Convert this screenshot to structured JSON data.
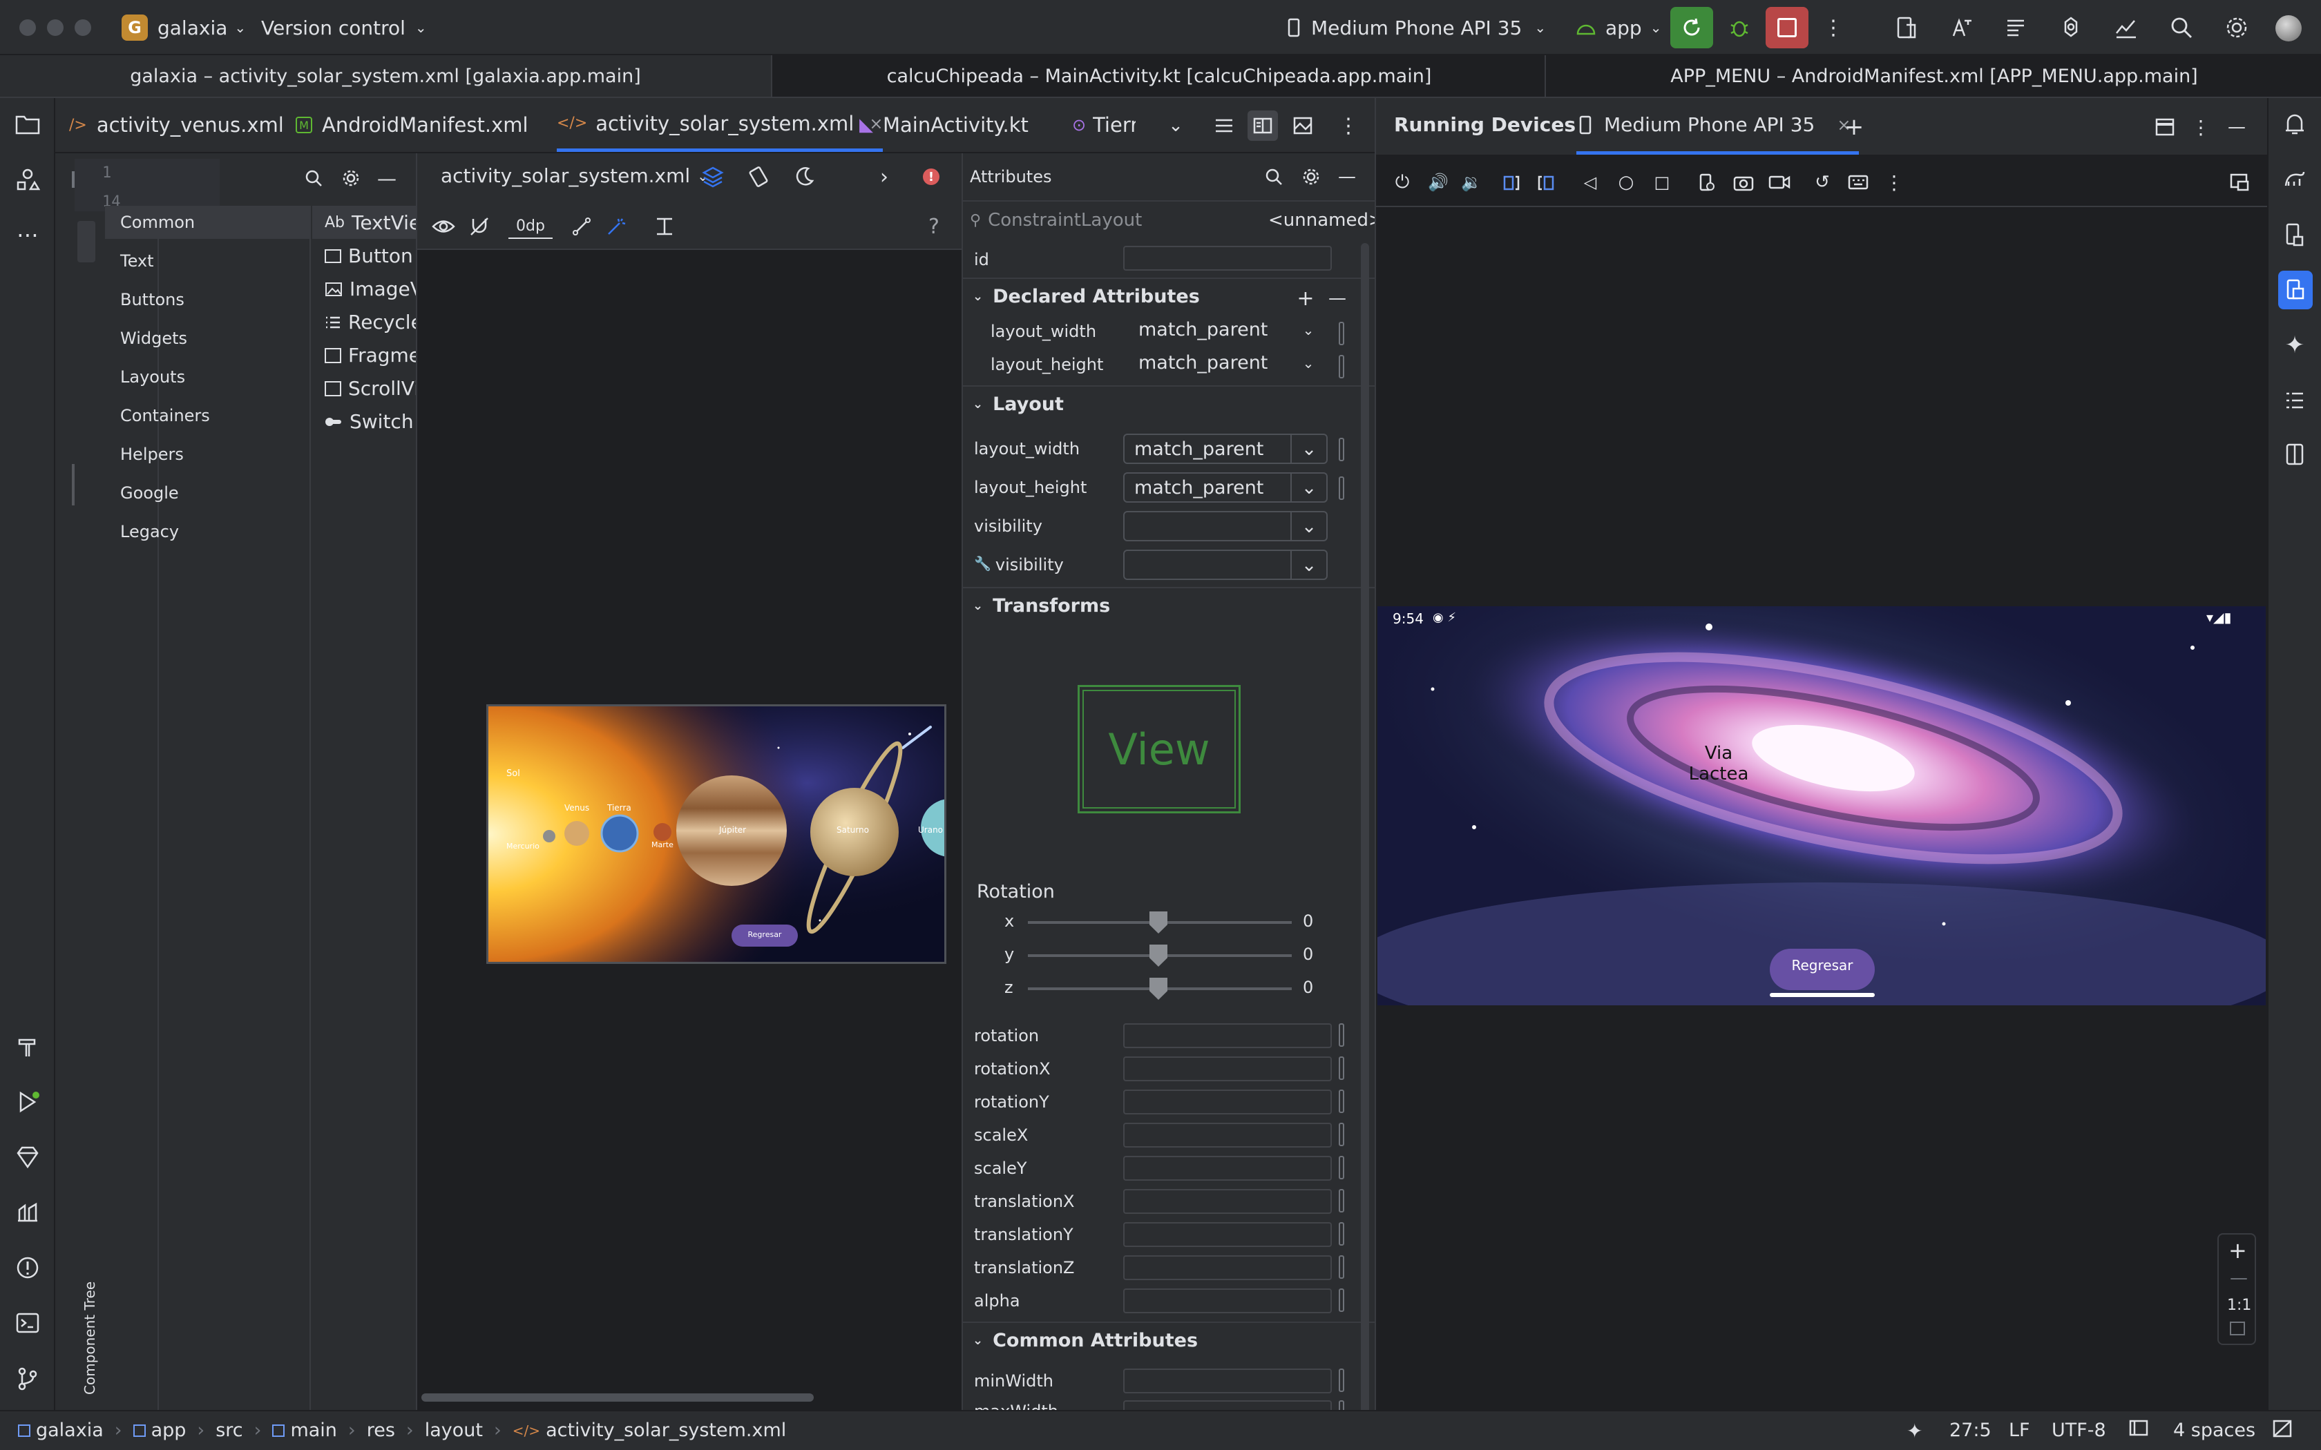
{
  "titlebar": {
    "project_initial": "G",
    "project": "galaxia",
    "vcs": "Version control",
    "device": "Medium Phone API 35",
    "run_config": "app"
  },
  "window_tabs": [
    "galaxia – activity_solar_system.xml [galaxia.app.main]",
    "calcuChipeada – MainActivity.kt [calcuChipeada.app.main]",
    "APP_MENU – AndroidManifest.xml [APP_MENU.app.main]"
  ],
  "editor_tabs": [
    {
      "label": "activity_venus.xml",
      "icon": "xml-file-icon"
    },
    {
      "label": "AndroidManifest.xml",
      "icon": "manifest-file-icon"
    },
    {
      "label": "activity_solar_system.xml",
      "icon": "xml-file-icon",
      "active": true
    },
    {
      "label": "MainActivity.kt",
      "icon": "kotlin-file-icon"
    },
    {
      "label": "Tierra",
      "icon": "layout-file-icon"
    }
  ],
  "gutter": {
    "line1": "1",
    "line2": "14"
  },
  "palette": {
    "categories": [
      "Common",
      "Text",
      "Buttons",
      "Widgets",
      "Layouts",
      "Containers",
      "Helpers",
      "Google",
      "Legacy"
    ],
    "selected_category": "Common",
    "widgets": [
      "TextView",
      "Button",
      "ImageVi...",
      "Recycler...",
      "Fragmen...",
      "ScrollView",
      "Switch"
    ],
    "textview_glyph": "Ab",
    "component_tree": "Component Tree"
  },
  "design": {
    "file": "activity_solar_system.xml",
    "margin": "0dp",
    "help": "?",
    "preview": {
      "labels": {
        "sol": "Sol",
        "mercurio": "Mercurio",
        "venus": "Venus",
        "tierra": "Tierra",
        "marte": "Marte",
        "jupiter": "Júpiter",
        "saturno": "Saturno",
        "urano": "Urano"
      },
      "button": "Regresar"
    }
  },
  "attributes": {
    "title": "Attributes",
    "component": "ConstraintLayout",
    "component_name": "<unnamed>",
    "id_label": "id",
    "declared": {
      "title": "Declared Attributes",
      "rows": [
        {
          "name": "layout_width",
          "value": "match_parent"
        },
        {
          "name": "layout_height",
          "value": "match_parent"
        }
      ]
    },
    "layout": {
      "title": "Layout",
      "rows": [
        {
          "name": "layout_width",
          "value": "match_parent"
        },
        {
          "name": "layout_height",
          "value": "match_parent"
        },
        {
          "name": "visibility",
          "value": ""
        },
        {
          "name": "visibility",
          "value": ""
        }
      ]
    },
    "transforms": {
      "title": "Transforms",
      "view_preview": "View",
      "rotation_label": "Rotation",
      "axes": [
        {
          "name": "x",
          "value": "0"
        },
        {
          "name": "y",
          "value": "0"
        },
        {
          "name": "z",
          "value": "0"
        }
      ],
      "fields": [
        "rotation",
        "rotationX",
        "rotationY",
        "scaleX",
        "scaleY",
        "translationX",
        "translationY",
        "translationZ",
        "alpha"
      ]
    },
    "common": {
      "title": "Common Attributes",
      "fields": [
        "minWidth",
        "maxWidth"
      ]
    }
  },
  "running": {
    "title": "Running Devices",
    "device_tab": "Medium Phone API 35",
    "phone": {
      "time": "9:54",
      "title": "Via Lactea",
      "button": "Regresar"
    },
    "zoom": "1:1"
  },
  "statusbar": {
    "breadcrumbs": [
      "galaxia",
      "app",
      "src",
      "main",
      "res",
      "layout",
      "activity_solar_system.xml"
    ],
    "position": "27:5",
    "line_sep": "LF",
    "encoding": "UTF-8",
    "indent": "4 spaces"
  }
}
